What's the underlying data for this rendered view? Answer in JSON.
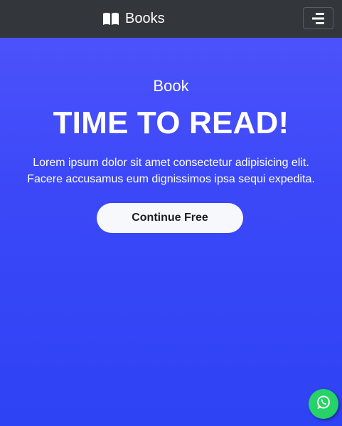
{
  "navbar": {
    "brand": {
      "icon": "open-book-icon",
      "label": "Books"
    },
    "toggler": {
      "icon": "hamburger-menu-icon"
    },
    "background": "#33363b"
  },
  "hero": {
    "eyebrow": "Book",
    "headline": "TIME TO READ!",
    "lede_line1": "Lorem ipsum dolor sit amet consectetur adipisicing elit.",
    "lede_line2": "Facere accusamus eum dignissimos ipsa sequi expedita.",
    "cta_label": "Continue Free",
    "gradient_top": "#4c52fb",
    "gradient_bottom": "#2e43f4"
  },
  "floating": {
    "whatsapp": {
      "icon": "whatsapp-icon",
      "color": "#25d366"
    }
  }
}
